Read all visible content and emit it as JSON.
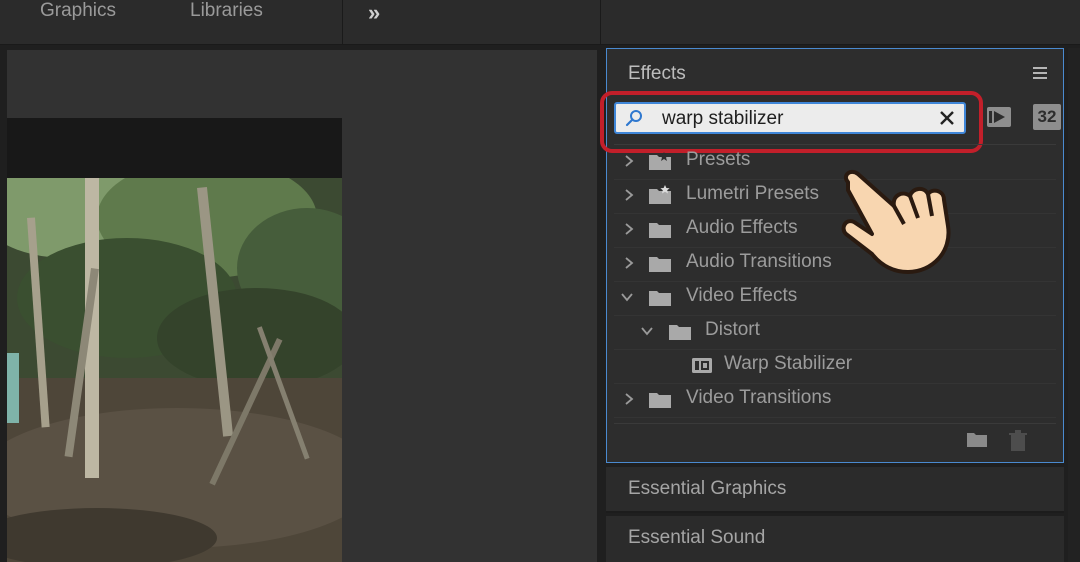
{
  "tabs": {
    "graphics": "Graphics",
    "libraries": "Libraries",
    "more": "»"
  },
  "effects": {
    "title": "Effects",
    "search": {
      "value": "warp stabilizer",
      "placeholder": ""
    },
    "buttons": {
      "accelerated_label": "",
      "bit32_label": "32"
    },
    "tree": [
      {
        "label": "Presets",
        "expanded": false,
        "icon": "presets-folder-icon"
      },
      {
        "label": "Lumetri Presets",
        "expanded": false,
        "icon": "lumetri-folder-icon"
      },
      {
        "label": "Audio Effects",
        "expanded": false,
        "icon": "folder-icon"
      },
      {
        "label": "Audio Transitions",
        "expanded": false,
        "icon": "folder-icon"
      },
      {
        "label": "Video Effects",
        "expanded": true,
        "icon": "folder-icon"
      },
      {
        "label": "Distort",
        "expanded": true,
        "icon": "folder-icon"
      },
      {
        "label": "Warp Stabilizer",
        "icon": "effect-icon"
      },
      {
        "label": "Video Transitions",
        "expanded": false,
        "icon": "folder-icon"
      }
    ]
  },
  "docked_panels": {
    "essential_graphics": "Essential Graphics",
    "essential_sound": "Essential Sound"
  },
  "colors": {
    "accent": "#3f86d8",
    "highlight": "#c21f2a",
    "hand": "#f8d6b0"
  }
}
